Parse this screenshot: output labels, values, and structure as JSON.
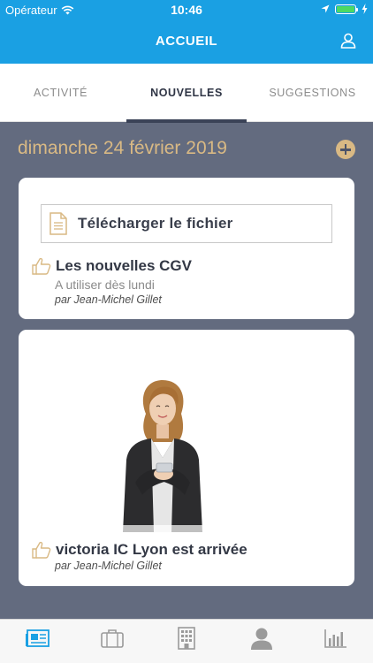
{
  "status_bar": {
    "carrier": "Opérateur",
    "time": "10:46"
  },
  "header": {
    "title": "ACCUEIL",
    "profile_icon": "user-icon"
  },
  "tabs": [
    {
      "label": "ACTIVITÉ",
      "active": false
    },
    {
      "label": "NOUVELLES",
      "active": true
    },
    {
      "label": "SUGGESTIONS",
      "active": false
    }
  ],
  "feed": {
    "date": "dimanche 24 février 2019",
    "add_icon": "plus-circle-icon",
    "posts": [
      {
        "attachment_label": "Télécharger le fichier",
        "title": "Les nouvelles CGV",
        "subtitle": "A utiliser dès lundi",
        "author": "par Jean-Michel Gillet"
      },
      {
        "title": "victoria IC Lyon est arrivée",
        "author": "par Jean-Michel Gillet"
      }
    ]
  },
  "tabbar": {
    "items": [
      "news-icon",
      "briefcase-icon",
      "building-icon",
      "person-icon",
      "chart-icon"
    ],
    "active_index": 0
  },
  "colors": {
    "header": "#1aa0e3",
    "background": "#636b7f",
    "accent_gold": "#d9b984",
    "tabbar_active": "#1aa0e3"
  }
}
